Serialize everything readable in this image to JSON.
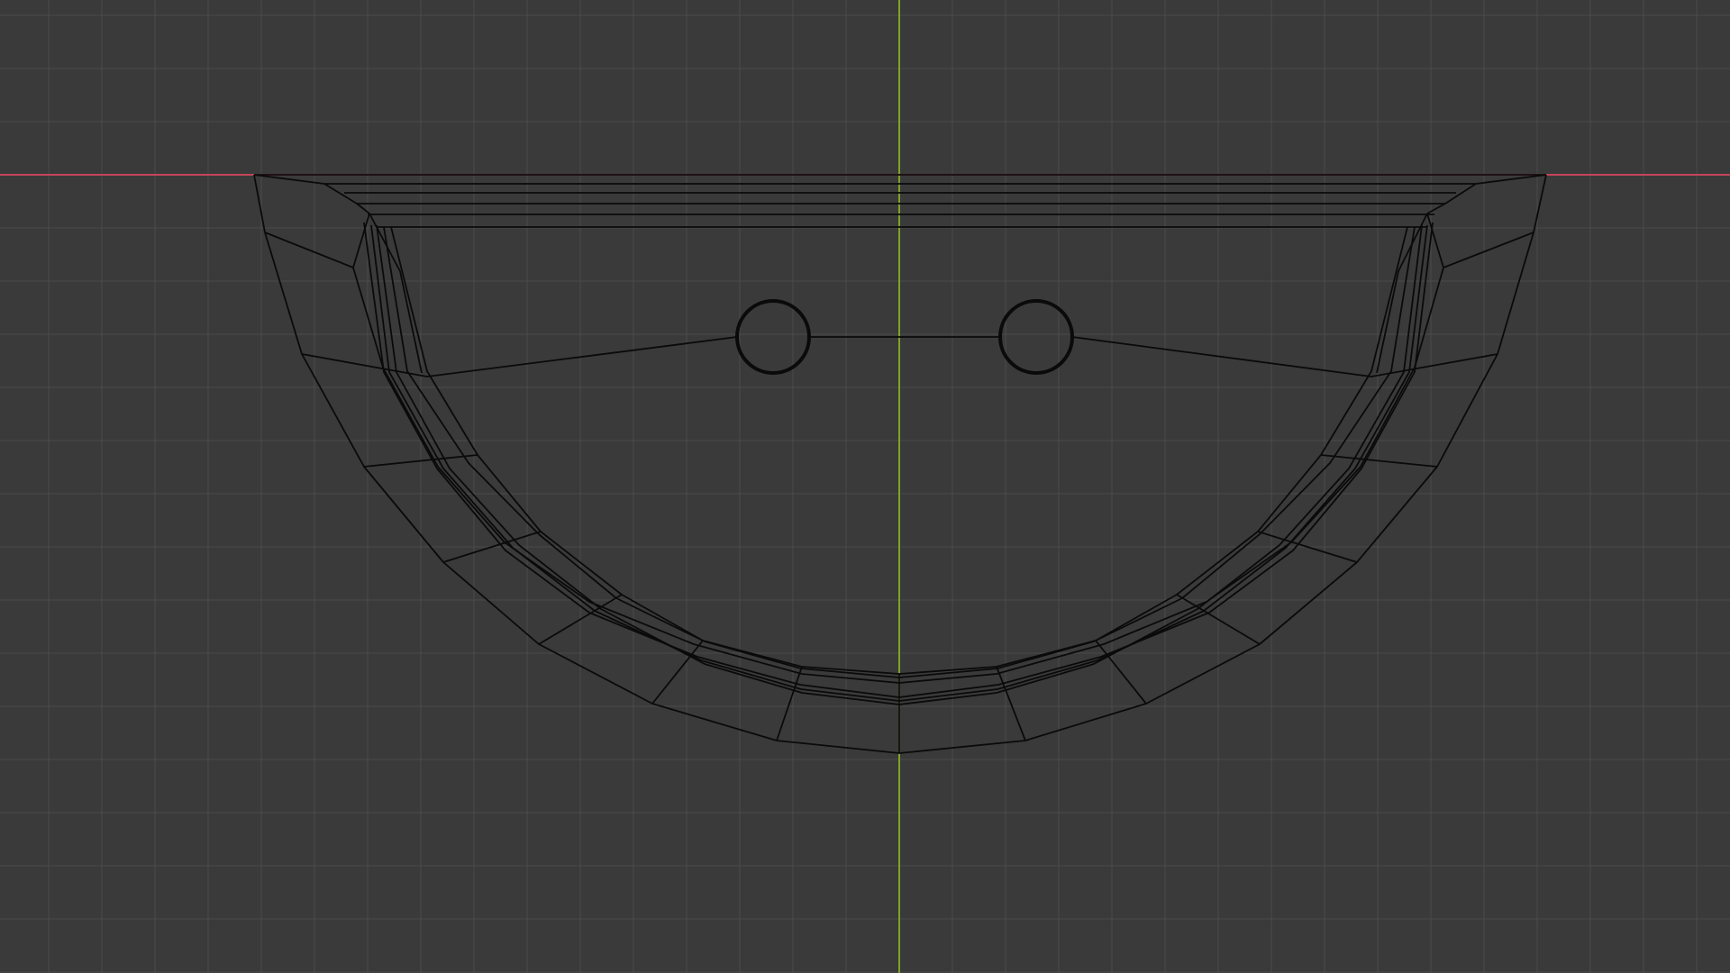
{
  "viewport": {
    "view": "front-orthographic",
    "background_color": "#3a3a3a",
    "grid_color": "#4b4b4b",
    "x_axis_color": "#c2465a",
    "z_axis_color": "#7da325",
    "wire_color": "#0a0a0a",
    "object": "semicircular-dish-wireframe",
    "holes": [
      "left-hole",
      "right-hole"
    ]
  }
}
